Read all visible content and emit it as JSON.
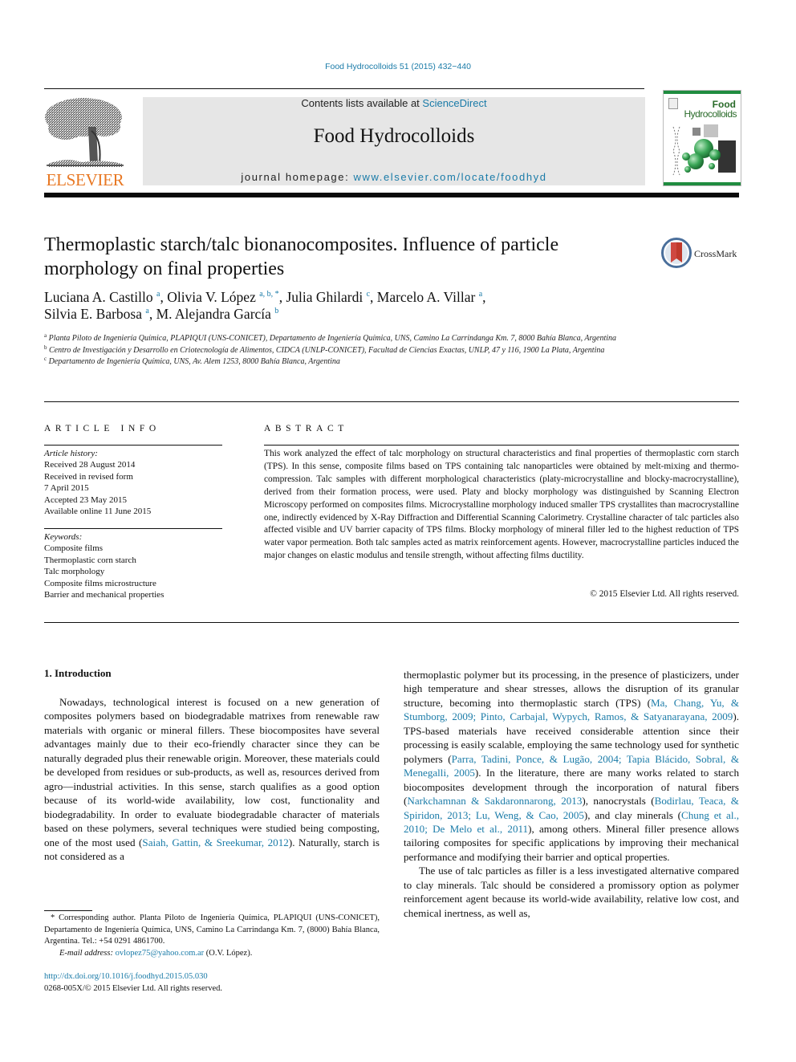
{
  "running_head": "Food Hydrocolloids 51 (2015) 432−440",
  "masthead": {
    "contents_prefix": "Contents lists available at ",
    "contents_link": "ScienceDirect",
    "journal_title": "Food Hydrocolloids",
    "homepage_prefix": "journal homepage: ",
    "homepage_link": "www.elsevier.com/locate/foodhyd",
    "publisher_logo_text": "ELSEVIER",
    "cover_word1": "Food",
    "cover_word2": "Hydrocolloids",
    "colors": {
      "link": "#1a7ba8",
      "publisher_orange": "#e87722",
      "cover_green": "#1f8c3f",
      "masthead_gray": "#e6e6e6"
    }
  },
  "article": {
    "title": "Thermoplastic starch/talc bionanocomposites. Influence of particle morphology on final properties",
    "crossmark_label": "CrossMark",
    "authors": [
      {
        "name": "Luciana A. Castillo",
        "sup": "a",
        "sep": ", "
      },
      {
        "name": "Olivia V. López",
        "sup": "a, b, *",
        "sep": ", "
      },
      {
        "name": "Julia Ghilardi",
        "sup": "c",
        "sep": ", "
      },
      {
        "name": "Marcelo A. Villar",
        "sup": "a",
        "sep": ", "
      },
      {
        "name": "Silvia E. Barbosa",
        "sup": "a",
        "sep": ", "
      },
      {
        "name": "M. Alejandra García",
        "sup": "b",
        "sep": ""
      }
    ],
    "affiliations": [
      {
        "key": "a",
        "text": "Planta Piloto de Ingeniería Química, PLAPIQUI (UNS-CONICET), Departamento de Ingeniería Química, UNS, Camino La Carrindanga Km. 7, 8000 Bahía Blanca, Argentina"
      },
      {
        "key": "b",
        "text": "Centro de Investigación y Desarrollo en Criotecnología de Alimentos, CIDCA (UNLP-CONICET), Facultad de Ciencias Exactas, UNLP, 47 y 116, 1900 La Plata, Argentina"
      },
      {
        "key": "c",
        "text": "Departamento de Ingeniería Química, UNS, Av. Alem 1253, 8000 Bahía Blanca, Argentina"
      }
    ]
  },
  "article_info": {
    "heading": "ARTICLE INFO",
    "history_label": "Article history:",
    "history": [
      "Received 28 August 2014",
      "Received in revised form",
      "7 April 2015",
      "Accepted 23 May 2015",
      "Available online 11 June 2015"
    ],
    "keywords_label": "Keywords:",
    "keywords": [
      "Composite films",
      "Thermoplastic corn starch",
      "Talc morphology",
      "Composite films microstructure",
      "Barrier and mechanical properties"
    ]
  },
  "abstract": {
    "heading": "ABSTRACT",
    "text": "This work analyzed the effect of talc morphology on structural characteristics and final properties of thermoplastic corn starch (TPS). In this sense, composite films based on TPS containing talc nanoparticles were obtained by melt-mixing and thermo-compression. Talc samples with different morphological characteristics (platy-microcrystalline and blocky-macrocrystalline), derived from their formation pro­cess, were used. Platy and blocky morphology was distinguished by Scanning Electron Microscopy performed on composites films. Microcrystalline morphology induced smaller TPS crystallites than macrocrystalline one, indirectly evidenced by X-Ray Diffraction and Differential Scanning Calorimetry. Crystalline character of talc particles also affected visible and UV barrier capacity of TPS films. Blocky morphology of mineral filler led to the highest reduction of TPS water vapor permeation. Both talc samples acted as matrix reinforcement agents. However, macrocrystalline particles induced the major changes on elastic modulus and tensile strength, without affecting films ductility.",
    "copyright": "© 2015 Elsevier Ltd. All rights reserved."
  },
  "introduction": {
    "heading": "1.  Introduction",
    "left_p1": [
      {
        "t": "Nowadays, technological interest is focused on a new generation of composites polymers based on biodegradable matrixes from renewable raw materials with organic or mineral fillers. These biocomposites have several advantages mainly due to their eco-friendly character since they can be naturally degraded plus their renewable origin. Moreover, these materials could be developed from residues or sub-products, as well as, resources derived from agro—industrial activities. In this sense, starch qualifies as a good option because of its world-wide availability, low cost, functionality and biodegradability. In order to evaluate biodegradable character of materials based on these polymers, several techniques were studied being composting, one of the most used ("
      },
      {
        "link": "Saiah, Gattin, & Sreekumar, 2012"
      },
      {
        "t": "). Naturally, starch is not considered as a"
      }
    ],
    "right_p1": [
      {
        "t": "thermoplastic polymer but its processing, in the presence of plas­ticizers, under high temperature and shear stresses, allows the disruption of its granular structure, becoming into thermoplastic starch (TPS) ("
      },
      {
        "link": "Ma, Chang, Yu, & Stumborg, 2009; Pinto, Carbajal, Wypych, Ramos, & Satyanarayana, 2009"
      },
      {
        "t": "). TPS-based materials have received considerable attention since their processing is easily scalable, employing the same technology used for synthetic poly­mers ("
      },
      {
        "link": "Parra, Tadini, Ponce, & Lugão, 2004; Tapia Blácido, Sobral, & Menegalli, 2005"
      },
      {
        "t": "). In the literature, there are many works related to starch biocomposites development through the incorporation of natural fibers ("
      },
      {
        "link": "Narkchamnan & Sakdaronnarong, 2013"
      },
      {
        "t": "), nano­crystals ("
      },
      {
        "link": "Bodirlau, Teaca, & Spiridon, 2013; Lu, Weng, & Cao, 2005"
      },
      {
        "t": "), and clay minerals ("
      },
      {
        "link": "Chung et al., 2010; De Melo et al., 2011"
      },
      {
        "t": "), among others. Mineral filler presence allows tailoring composites for specific applications by improving their mechanical performance and modifying their barrier and optical properties."
      }
    ],
    "right_p2": "The use of talc particles as filler is a less investigated alternative compared to clay minerals. Talc should be considered a promissory option as polymer reinforcement agent because its world-wide availability, relative low cost, and chemical inertness, as well as,"
  },
  "footnote": {
    "corresponding": "* Corresponding author. Planta Piloto de Ingeniería Química, PLAPIQUI (UNS-CONICET), Departamento de Ingeniería Química, UNS, Camino La Carrindanga Km. 7, (8000) Bahía Blanca, Argentina. Tel.: +54 0291 4861700.",
    "email_label": "E-mail address: ",
    "email": "ovlopez75@yahoo.com.ar",
    "email_suffix": " (O.V. López).",
    "doi": "http://dx.doi.org/10.1016/j.foodhyd.2015.05.030",
    "issn": "0268-005X/© 2015 Elsevier Ltd. All rights reserved."
  }
}
